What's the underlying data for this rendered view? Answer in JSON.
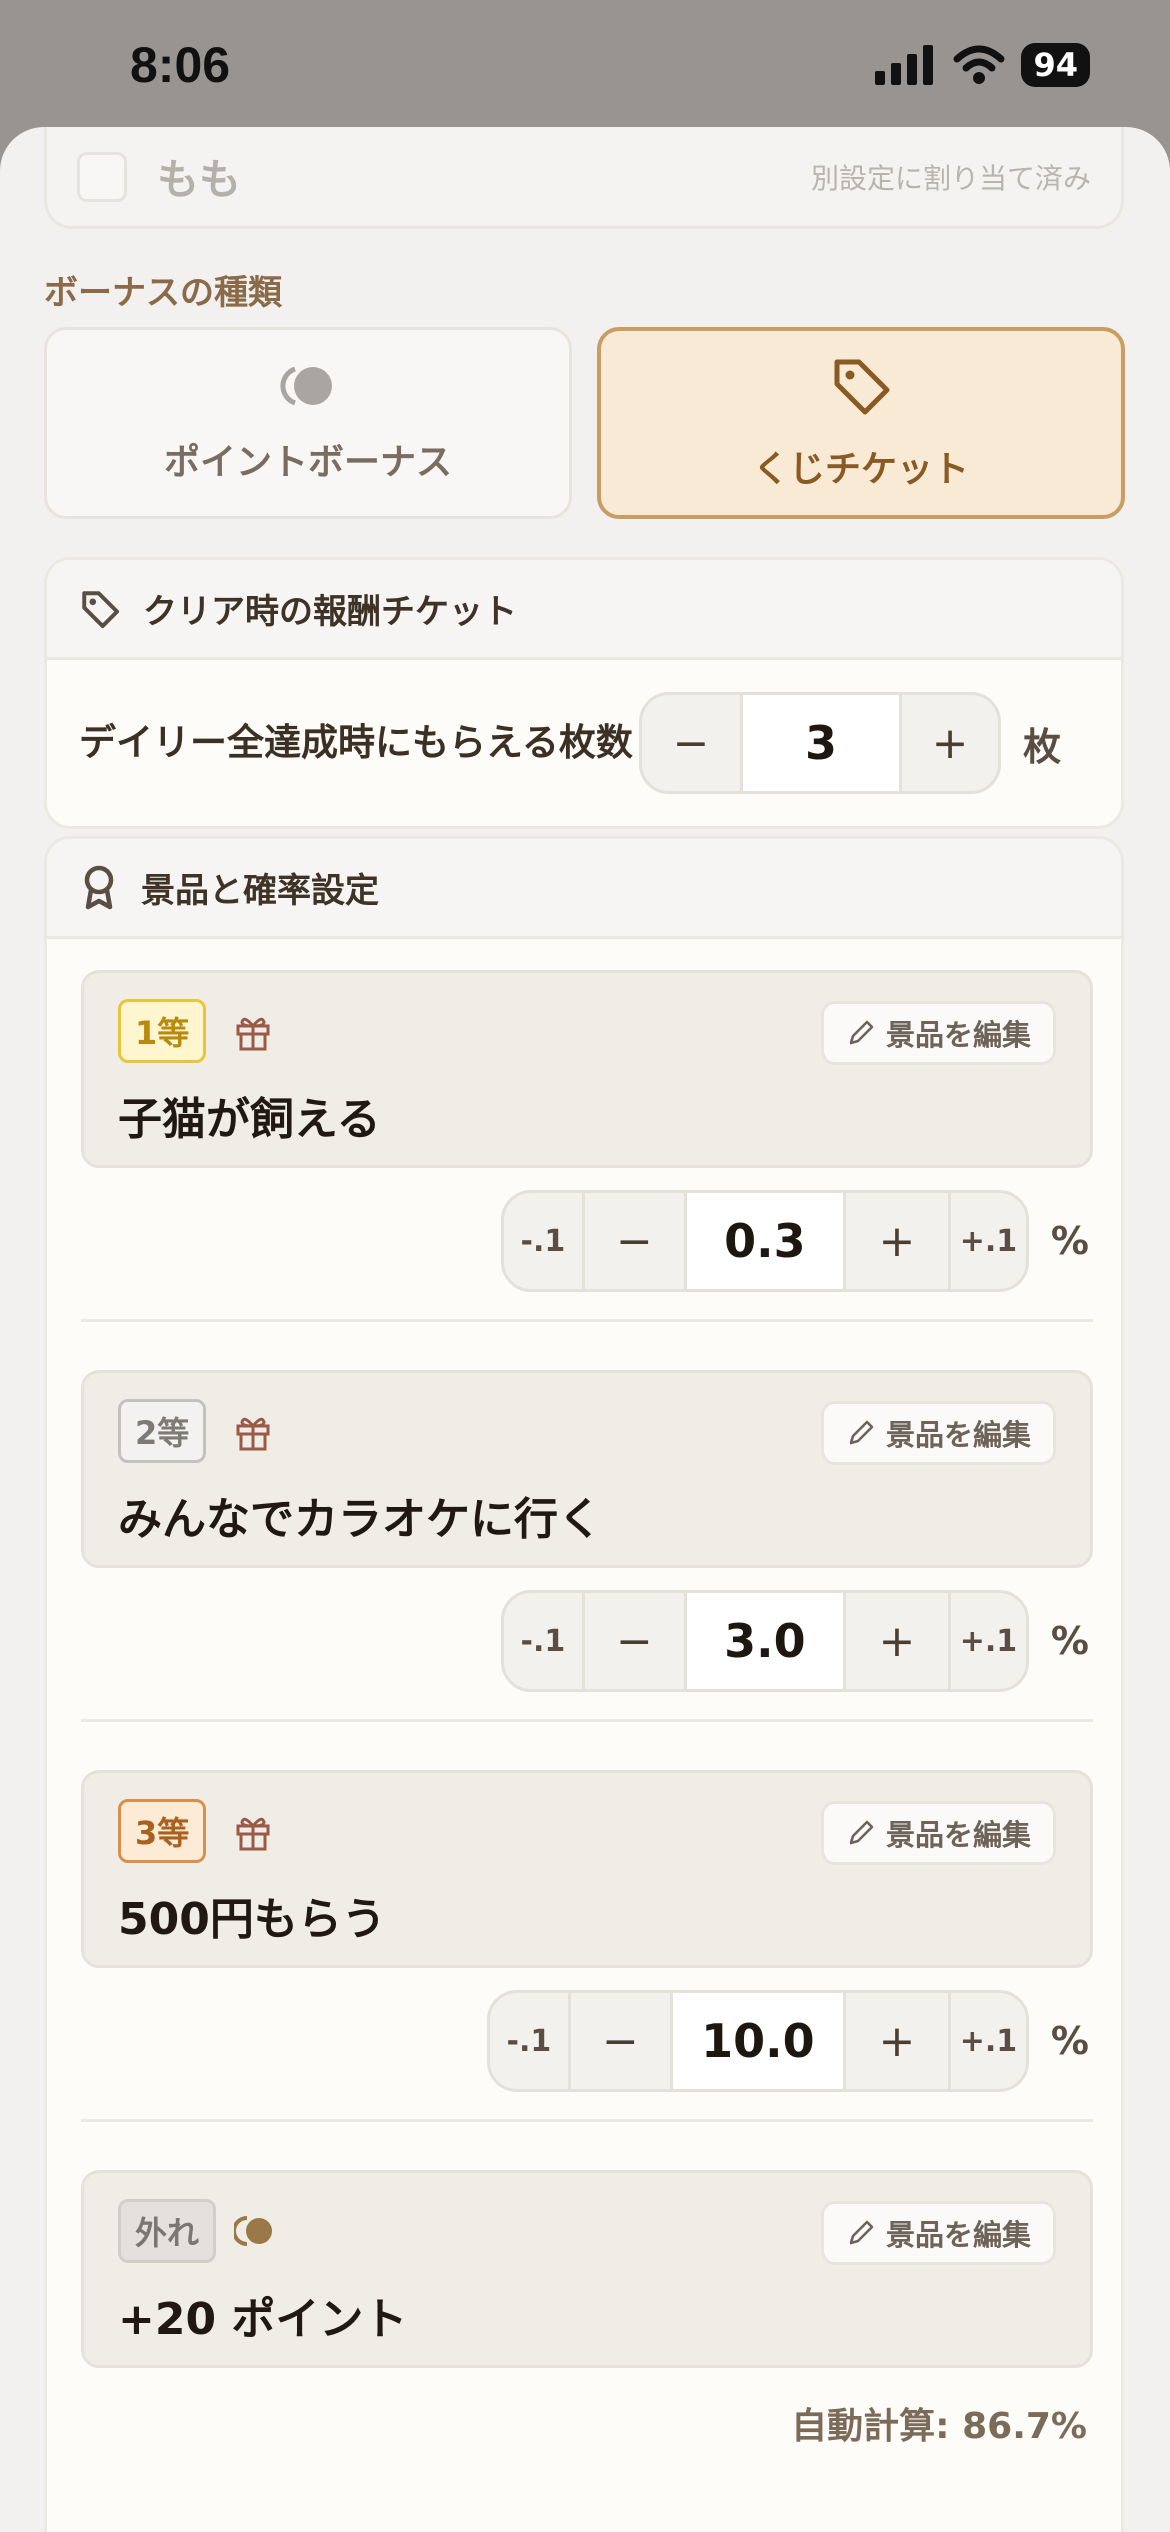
{
  "status_bar": {
    "time": "8:06",
    "battery": "94"
  },
  "assignment": {
    "name": "もも",
    "status": "別設定に割り当て済み"
  },
  "bonus_type": {
    "label": "ボーナスの種類",
    "options": [
      {
        "label": "ポイントボーナス",
        "icon": "coins-icon",
        "selected": false
      },
      {
        "label": "くじチケット",
        "icon": "tag-icon",
        "selected": true
      }
    ]
  },
  "ticket_section": {
    "title": "クリア時の報酬チケット",
    "description": "デイリー全達成時にもらえる枚数",
    "value": "3",
    "minus": "−",
    "plus": "+",
    "unit": "枚"
  },
  "prize_section": {
    "title": "景品と確率設定",
    "edit_label": "景品を編集",
    "step_down": "-.1",
    "step_up": "+.1",
    "minus": "−",
    "plus": "+",
    "unit": "%",
    "prizes": [
      {
        "rank": "1等",
        "name": "子猫が飼える",
        "probability": "0.3",
        "icon": "gift-icon"
      },
      {
        "rank": "2等",
        "name": "みんなでカラオケに行く",
        "probability": "3.0",
        "icon": "gift-icon"
      },
      {
        "rank": "3等",
        "name": "500円もらう",
        "probability": "10.0",
        "icon": "gift-icon"
      }
    ],
    "miss": {
      "rank": "外れ",
      "name": "+20 ポイント",
      "icon": "coins-icon"
    },
    "auto_calc": "自動計算: 86.7%"
  },
  "colors": {
    "accent": "#c99d64",
    "accent_bg": "#f9ead6",
    "rank1": "#e8c63a",
    "rank3": "#d9914a"
  }
}
